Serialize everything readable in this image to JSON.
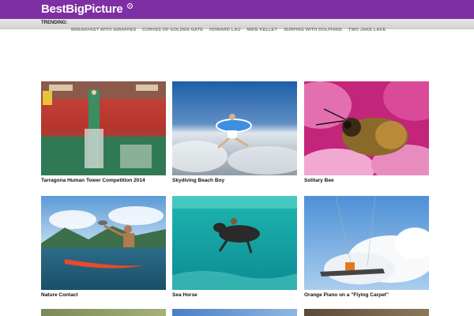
{
  "header": {
    "logo": "BestBigPicture",
    "logo_mark": "®"
  },
  "trending": {
    "label": "TRENDING:",
    "links": [
      "BREAKFAST WITH GIRAFFES",
      "CURVES OF GOLDEN GATE",
      "HOWARD LAU",
      "MIKE KELLEY",
      "SURFING WITH DOLPHINS",
      "TWO JAKE LAKE"
    ]
  },
  "gallery": {
    "items": [
      {
        "caption": "Tarragona Human Tower Competition 2014",
        "icon": "crowd-human-tower-image"
      },
      {
        "caption": "Skydiving Beach Boy",
        "icon": "skydiver-image"
      },
      {
        "caption": "Solitary Bee",
        "icon": "bee-on-flower-image"
      },
      {
        "caption": "Nature Contact",
        "icon": "surfer-with-bird-image"
      },
      {
        "caption": "Sea Horse",
        "icon": "horse-underwater-image"
      },
      {
        "caption": "Orange Piano on a \"Flying Carpet\"",
        "icon": "flying-piano-image"
      }
    ]
  },
  "colors": {
    "brand": "#7e2fa3",
    "trend_bar": "#dcdcdc",
    "trend_link": "#7a7a7a"
  }
}
